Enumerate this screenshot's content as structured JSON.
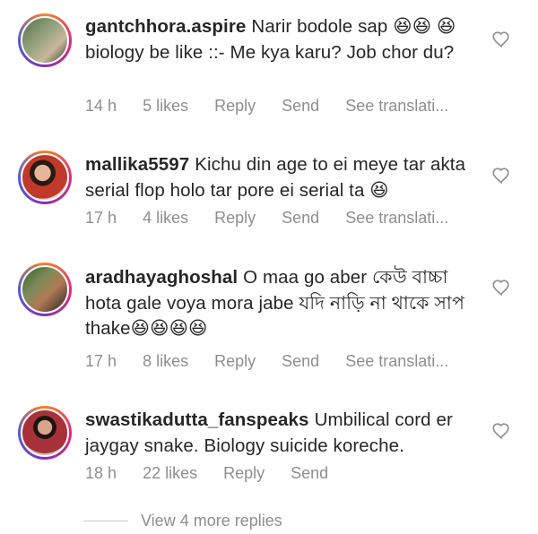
{
  "comments": [
    {
      "username": "gantchhora.aspire",
      "text": "Narir bodole sap 😆😆 😆 biology be like ::- Me kya karu? Job chor du?",
      "time": "14 h",
      "likes": "5 likes",
      "reply": "Reply",
      "send": "Send",
      "translate": "See translati..."
    },
    {
      "username": "mallika5597",
      "text": "Kichu din age to ei meye tar akta serial flop holo tar pore ei serial ta 😆",
      "time": "17 h",
      "likes": "4 likes",
      "reply": "Reply",
      "send": "Send",
      "translate": "See translati..."
    },
    {
      "username": "aradhayaghoshal",
      "text": "O maa go aber কেউ বাচ্চা hota gale voya mora jabe যদি নাড়ি না থাকে সাপ thake😆😆😆😆",
      "time": "17 h",
      "likes": "8 likes",
      "reply": "Reply",
      "send": "Send",
      "translate": "See translati..."
    },
    {
      "username": "swastikadutta_fanspeaks",
      "text": "Umbilical cord er jaygay snake. Biology suicide koreche.",
      "time": "18 h",
      "likes": "22 likes",
      "reply": "Reply",
      "send": "Send"
    }
  ],
  "view_more": "View 4 more replies",
  "colors": {
    "text": "#262626",
    "meta": "#8e8e8e",
    "ring_start": "#f58529",
    "ring_end": "#515bd4"
  },
  "icons": {
    "like": "heart-outline-icon"
  }
}
